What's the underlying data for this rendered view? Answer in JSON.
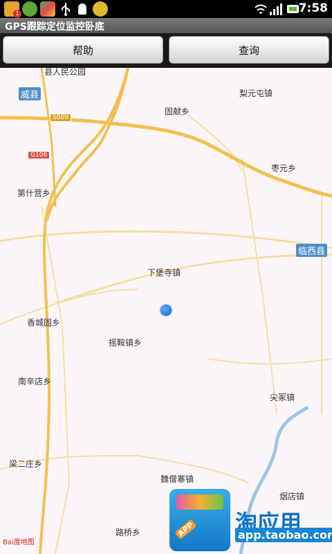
{
  "status_bar": {
    "time": "7:58",
    "notification_badge": "1",
    "icons": [
      "app-notification-icon",
      "check-app-icon",
      "stripe-app-icon",
      "usb-icon",
      "android-icon",
      "download-icon",
      "wifi-icon",
      "signal-icon",
      "battery-icon"
    ]
  },
  "app": {
    "title": "GPS跟踪定位监控卧底"
  },
  "toolbar": {
    "help_label": "帮助",
    "query_label": "查询"
  },
  "map": {
    "labels": {
      "park": "县人民公园",
      "weixian": "威县",
      "liyuantun": "梨元屯镇",
      "guxian": "固献乡",
      "s009": "S009",
      "g106": "G106",
      "zaoyuan": "枣元乡",
      "dishiying": "第什营乡",
      "linxi": "临西县",
      "xiabaosi": "下堡寺镇",
      "xiangchenggu": "香城固乡",
      "yaoqian": "摇鞍镇乡",
      "nanxindian": "南辛店乡",
      "jianzhong": "尖冢镇",
      "lianger": "梁二庄乡",
      "weisengzhai": "魏僧寨镇",
      "yandian": "烟店镇",
      "luqiao": "路桥乡",
      "baidu": "Bai度地图"
    }
  },
  "ad": {
    "text": "淘应用",
    "url": "app.taobao.com"
  },
  "colors": {
    "road_main": "#f2c14e",
    "road_minor": "#f6dfa3",
    "river": "#9dc6e8",
    "badge": "#4f8fc8",
    "location": "#1e78e8"
  }
}
